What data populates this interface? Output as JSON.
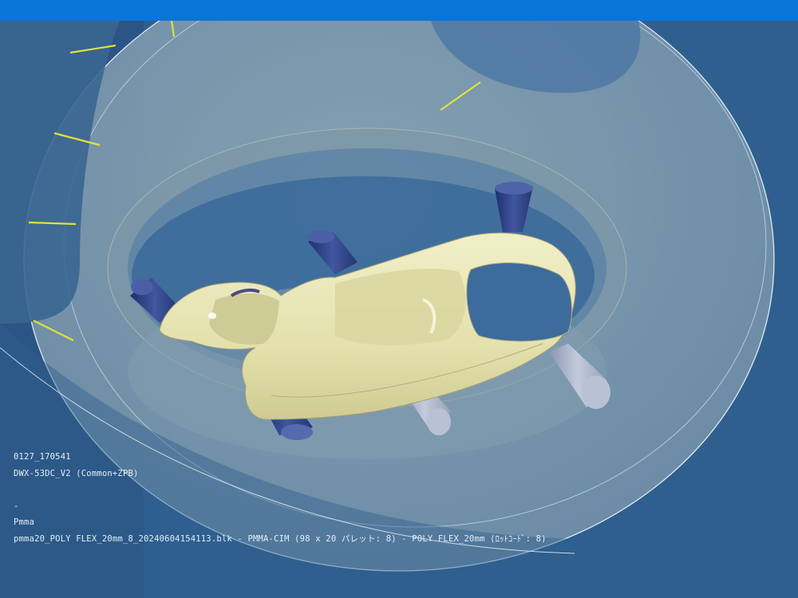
{
  "window": {
    "titlebar_color": "#0a74da"
  },
  "viewport": {
    "background_color": "#2f5f8e",
    "part_color": "#e8e6b8",
    "connector_color": "#2b3f84",
    "support_pin_color": "#a8b2c9",
    "guide_line_color": "#e3e03a",
    "icons": [
      "dental-bridge-model",
      "milling-connector-pin",
      "support-pin",
      "cam-disc-outline"
    ]
  },
  "info_overlay": {
    "line1": "0127_170541",
    "line2": "DWX-53DC_V2 (Common+ZPB)",
    "line3": "",
    "line4": "-",
    "line5": "Pmma",
    "line6": "pmma20_POLY FLEX_20mm_8_20240604154113.blk - PMMA-CIM (98 x 20 パレット: 8) - POLY FLEX_20mm  (ﾛｯﾄｺｰﾄﾞ: 8)"
  }
}
